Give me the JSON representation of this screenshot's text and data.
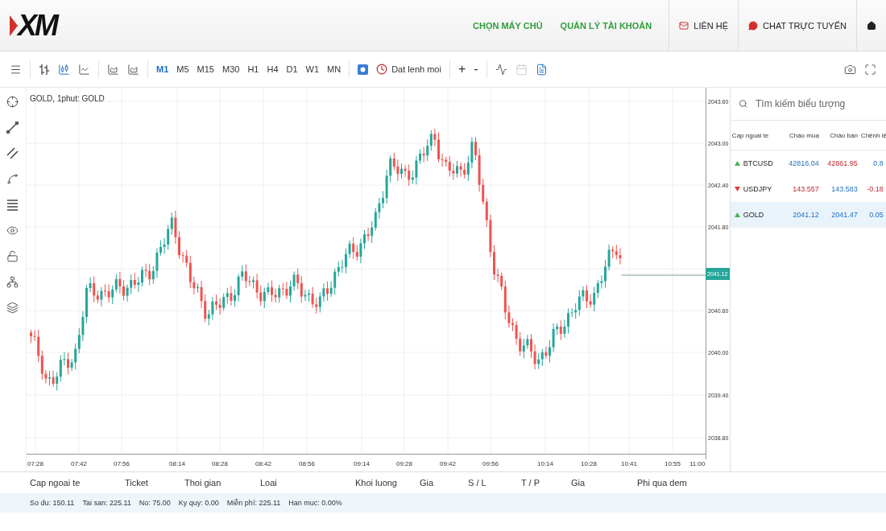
{
  "header": {
    "logo": "XM",
    "nav": [
      {
        "kind": "link",
        "label": "CHỌN MÁY CHỦ"
      },
      {
        "kind": "mail",
        "label": "LIÊN HỆ"
      },
      {
        "kind": "chat",
        "label": "CHAT TRỰC TUYẾN"
      },
      {
        "kind": "home"
      }
    ],
    "account_link": "QUẢN LÝ TÀI KHOẢN"
  },
  "toolbar": {
    "timeframes": [
      {
        "label": "M1",
        "selected": true
      },
      {
        "label": "M5",
        "selected": false
      },
      {
        "label": "M15",
        "selected": false
      },
      {
        "label": "M30",
        "selected": false
      },
      {
        "label": "H1",
        "selected": false
      },
      {
        "label": "H4",
        "selected": false
      },
      {
        "label": "D1",
        "selected": false
      },
      {
        "label": "W1",
        "selected": false
      },
      {
        "label": "MN",
        "selected": false
      }
    ],
    "order_button": "Dat lenh moi",
    "zoom_in": "+",
    "zoom_out": "-"
  },
  "chart": {
    "title": "GOLD, 1phut: GOLD",
    "price_ticks": [
      "2043.60",
      "2043.00",
      "2042.40",
      "2041.80",
      "2040.60",
      "2040.00",
      "2039.40",
      "2038.80"
    ],
    "current_price": "2041.12",
    "time_ticks": [
      "07:28",
      "07:42",
      "07:56",
      "08:14",
      "08:28",
      "08:42",
      "08:56",
      "09:14",
      "09:28",
      "09:42",
      "09:56",
      "10:14",
      "10:28",
      "10:41",
      "10:55",
      "11:00"
    ]
  },
  "watchlist": {
    "search": {
      "placeholder": "Tìm kiếm biểu tượng"
    },
    "columns": [
      "Cap ngoai te",
      "Chào mua",
      "Chào bán",
      "Chênh lệ"
    ],
    "rows": [
      {
        "symbol": "BTCUSD",
        "rising": true,
        "bid": "42816.04",
        "bid_rising": true,
        "ask": "42861.95",
        "ask_rising": false,
        "spread": "0.8",
        "spread_rising": true,
        "selected": false
      },
      {
        "symbol": "USDJPY",
        "rising": false,
        "bid": "143.557",
        "bid_rising": false,
        "ask": "143.583",
        "ask_rising": true,
        "spread": "-0.18",
        "spread_rising": false,
        "selected": false
      },
      {
        "symbol": "GOLD",
        "rising": true,
        "bid": "2041.12",
        "bid_rising": true,
        "ask": "2041.47",
        "ask_rising": true,
        "spread": "0.05",
        "spread_rising": true,
        "selected": true
      }
    ]
  },
  "positions": {
    "columns": [
      "Cap ngoai te",
      "Ticket",
      "Thoi gian",
      "Loai",
      "Khoi luong",
      "Gia",
      "S / L",
      "T / P",
      "Gia",
      "Phi qua dem"
    ]
  },
  "account": [
    "So du: 150.11",
    "Tai san: 225.11",
    "No: 75.00",
    "Ky quy: 0.00",
    "Miễn phí: 225.11",
    "Han muc: 0.00%"
  ]
}
